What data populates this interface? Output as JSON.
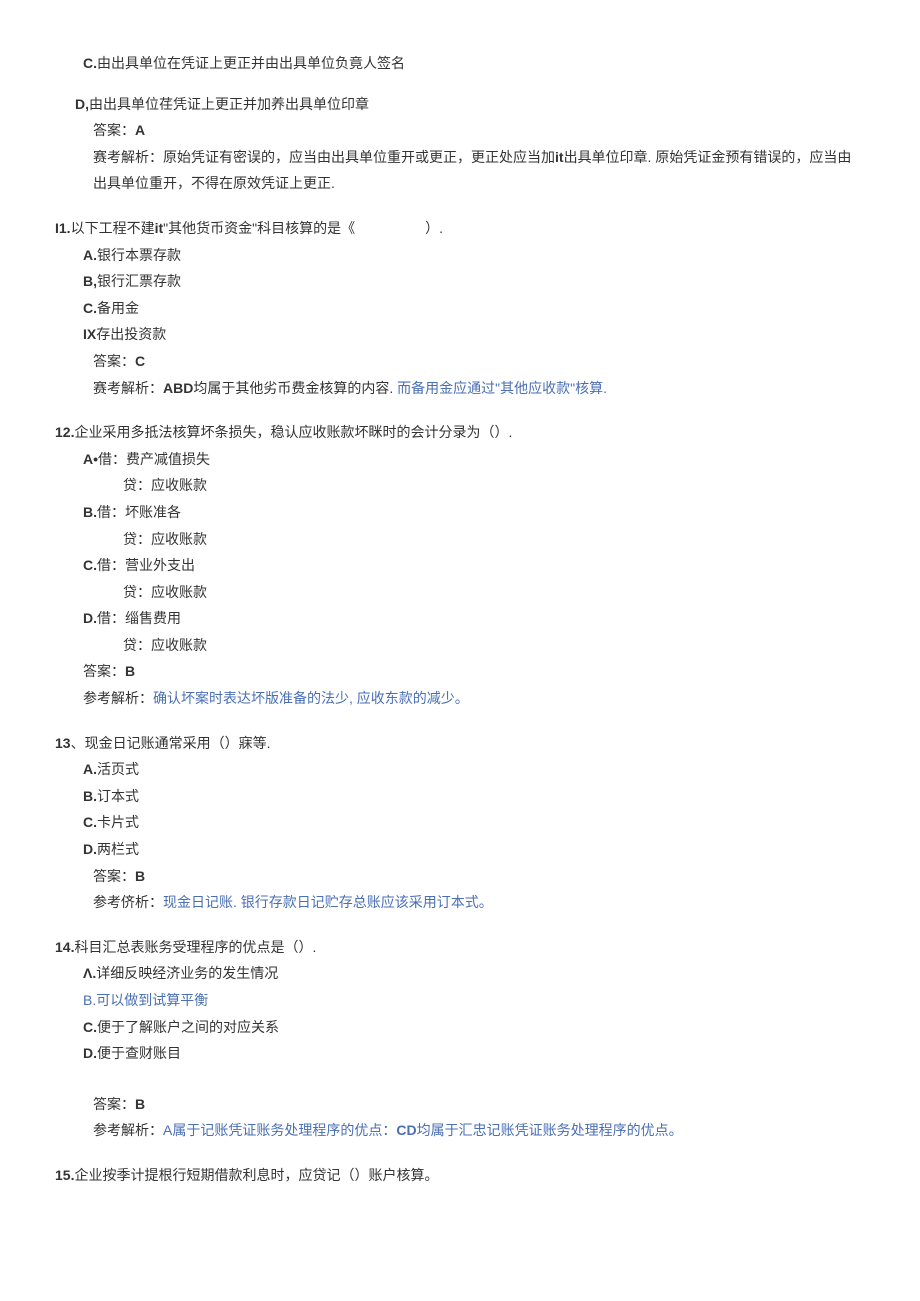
{
  "prelude": {
    "optC": "由出具单位在凭证上更正并由出具单位负竟人签名",
    "optD": "由出具单位荏凭证上更正并加养出具单位印章",
    "optD_label": "D,",
    "answer_label": "答案：",
    "answer_value": "A",
    "expl_label": "赛考解析：",
    "expl_text": "原始凭证有密误的，应当由出具单位重开或更正，更正处应当加",
    "expl_bold": "it",
    "expl_text2": "出具单位印章. 原始凭证金预有错误的，应当由出具单位重开，不得在原效凭证上更正."
  },
  "q11": {
    "num": "I1.",
    "stem1": "以下工程不建",
    "stem_bold": "it",
    "stem2": "\"其他货币资金\"科目核算的是《　　　　　）.",
    "optA_label": "A.",
    "optA": "银行本票存款",
    "optB_label": "B,",
    "optB": "银行汇票存款",
    "optC_label": "C.",
    "optC": "备用金",
    "optD_label": "IX",
    "optD": "存出投资款",
    "answer_label": "答案：",
    "answer_value": "C",
    "expl_label": "赛考解析：",
    "expl_bold": "ABD",
    "expl_text": "均属于其他劣币费金核算的内容. ",
    "expl_blue": "而备用金应通过\"其他应收款\"核算."
  },
  "q12": {
    "num": "12.",
    "stem": "企业采用多抵法核算坏条损失，稳认应收账款坏眯时的会计分录为（）.",
    "optA_label": "A•",
    "optA1": "借：费产减值损失",
    "optA2": "贷：应收账款",
    "optB_label": "B.",
    "optB1": "借：坏账准各",
    "optB2": "贷：应收账款",
    "optC_label": "C.",
    "optC1": "借：营业外支出",
    "optC2": "贷：应收账款",
    "optD_label": "D.",
    "optD1": "借：缁售费用",
    "optD2": "贷：应收账款",
    "answer_label": "答案：",
    "answer_value": "B",
    "expl_label": "参考解析：",
    "expl_blue": "确认坏案时表达坏版准备的法少, 应收东款的减少。"
  },
  "q13": {
    "num": "13",
    "sep": "、",
    "stem": "现金日记账通常采用（）寐等.",
    "optA_label": "A.",
    "optA": "活页式",
    "optB_label": "B.",
    "optB": "订本式",
    "optC_label": "C.",
    "optC": "卡片式",
    "optD_label": "D.",
    "optD": "两栏式",
    "answer_label": "答案：",
    "answer_value": "B",
    "expl_label": "参考侪析：",
    "expl_blue": "现金日记账. 银行存款日记贮存总账应该采用订本式。"
  },
  "q14": {
    "num": "14.",
    "stem": "科目汇总表账务受理程序的优点是（）.",
    "optA_label": "Λ.",
    "optA": "详细反映经济业务的发生情况",
    "optB_label": "B.",
    "optB": "可以做到试算平衡",
    "optC_label": "C.",
    "optC": "便于了解账户之间的对应关系",
    "optD_label": "D.",
    "optD": "便于查财账目",
    "answer_label": "答案：",
    "answer_value": "B",
    "expl_label": "参考解析：",
    "expl_blue1": "A",
    "expl_text1": "属于记账凭证账务处理程序的优点：",
    "expl_bold": "CD",
    "expl_text2": "均属于汇忠记账凭证账务处理程序的优点。"
  },
  "q15": {
    "num": "15.",
    "stem": "企业按季计提根行短期借款利息时，应贷记（）账户核算。"
  }
}
